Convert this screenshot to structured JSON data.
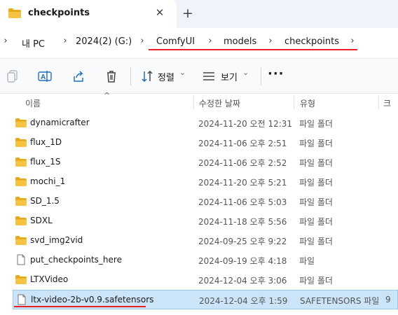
{
  "tab": {
    "title": "checkpoints",
    "close": "✕",
    "new_tab": "+"
  },
  "breadcrumb": {
    "lead_sep": "›",
    "items": [
      "내 PC",
      "2024(2) (G:)",
      "ComfyUI",
      "models",
      "checkpoints"
    ],
    "sep": "›"
  },
  "toolbar": {
    "sort_label": "정렬",
    "view_label": "보기",
    "more": "···",
    "chevron": "⌄"
  },
  "columns": {
    "name": "이름",
    "date": "수정한 날짜",
    "type": "유형",
    "size_partial": "크"
  },
  "files": [
    {
      "name": "dynamicrafter",
      "date": "2024-11-20 오전 12:31",
      "type": "파일 폴더",
      "kind": "folder"
    },
    {
      "name": "flux_1D",
      "date": "2024-11-06 오후 2:51",
      "type": "파일 폴더",
      "kind": "folder"
    },
    {
      "name": "flux_1S",
      "date": "2024-11-06 오후 2:52",
      "type": "파일 폴더",
      "kind": "folder"
    },
    {
      "name": "mochi_1",
      "date": "2024-11-20 오후 5:21",
      "type": "파일 폴더",
      "kind": "folder"
    },
    {
      "name": "SD_1.5",
      "date": "2024-11-06 오후 5:03",
      "type": "파일 폴더",
      "kind": "folder"
    },
    {
      "name": "SDXL",
      "date": "2024-11-18 오후 5:56",
      "type": "파일 폴더",
      "kind": "folder"
    },
    {
      "name": "svd_img2vid",
      "date": "2024-09-25 오후 9:22",
      "type": "파일 폴더",
      "kind": "folder"
    },
    {
      "name": "put_checkpoints_here",
      "date": "2024-09-19 오후 4:18",
      "type": "파일",
      "kind": "file"
    },
    {
      "name": "LTXVideo",
      "date": "2024-12-04 오후 3:06",
      "type": "파일 폴더",
      "kind": "folder"
    },
    {
      "name": "ltx-video-2b-v0.9.safetensors",
      "date": "2024-12-04 오후 1:59",
      "type": "SAFETENSORS 파일",
      "kind": "file",
      "selected": true,
      "size_partial": "9"
    }
  ],
  "colors": {
    "folder": "#f5c342",
    "folder_dark": "#e8a918",
    "selection": "#cce4f7",
    "annotation_red": "#e8202a"
  }
}
